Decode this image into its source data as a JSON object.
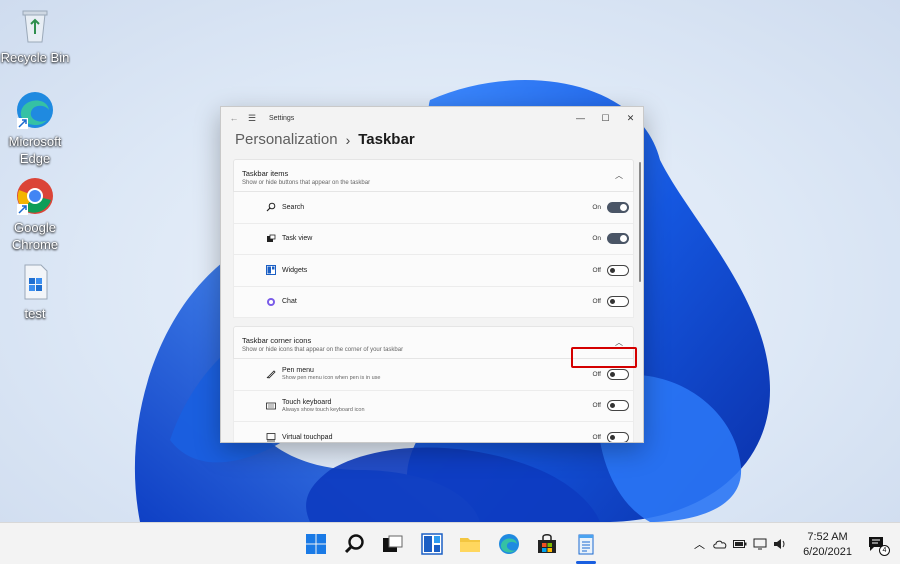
{
  "desktop": {
    "icons": [
      {
        "label": "Recycle Bin",
        "icon": "recycle-bin-icon"
      },
      {
        "label": "Microsoft Edge",
        "icon": "edge-icon"
      },
      {
        "label": "Google Chrome",
        "icon": "chrome-icon"
      },
      {
        "label": "test",
        "icon": "file-icon"
      }
    ]
  },
  "window": {
    "title": "Settings",
    "breadcrumb_parent": "Personalization",
    "breadcrumb_separator": "›",
    "breadcrumb_current": "Taskbar",
    "sections": [
      {
        "heading": "Taskbar items",
        "subtitle": "Show or hide buttons that appear on the taskbar",
        "items": [
          {
            "label": "Search",
            "state": "On",
            "on": true,
            "icon": "search-icon"
          },
          {
            "label": "Task view",
            "state": "On",
            "on": true,
            "icon": "task-view-icon"
          },
          {
            "label": "Widgets",
            "state": "Off",
            "on": false,
            "icon": "widgets-icon"
          },
          {
            "label": "Chat",
            "state": "Off",
            "on": false,
            "icon": "chat-icon"
          }
        ]
      },
      {
        "heading": "Taskbar corner icons",
        "subtitle": "Show or hide icons that appear on the corner of your taskbar",
        "items": [
          {
            "label": "Pen menu",
            "description": "Show pen menu icon when pen is in use",
            "state": "Off",
            "on": false,
            "icon": "pen-icon"
          },
          {
            "label": "Touch keyboard",
            "description": "Always show touch keyboard icon",
            "state": "Off",
            "on": false,
            "icon": "keyboard-icon"
          },
          {
            "label": "Virtual touchpad",
            "state": "Off",
            "on": false,
            "icon": "touchpad-icon"
          }
        ]
      }
    ]
  },
  "taskbar": {
    "apps": [
      "start-icon",
      "search-icon",
      "task-view-icon",
      "widgets-icon",
      "file-explorer-icon",
      "edge-icon",
      "store-icon",
      "notepad-icon"
    ],
    "time": "7:52 AM",
    "date": "6/20/2021",
    "notification_count": "4"
  },
  "colors": {
    "accent_blue": "#1a5fe0",
    "highlight_red": "#d40000",
    "toggle_on": "#4a5566"
  }
}
